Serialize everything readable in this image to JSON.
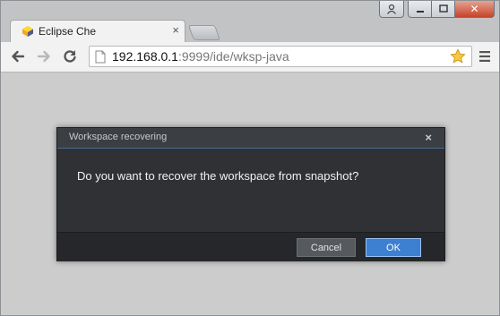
{
  "browser": {
    "tab": {
      "title": "Eclipse Che",
      "close_glyph": "×",
      "favicon": "eclipse-che-icon"
    },
    "window_controls": {
      "close_glyph": "✕"
    },
    "address": {
      "host": "192.168.0.1",
      "path": ":9999/ide/wksp-java"
    },
    "icons": [
      "back-arrow-icon",
      "forward-arrow-icon",
      "reload-icon",
      "page-icon",
      "star-icon",
      "menu-icon"
    ]
  },
  "dialog": {
    "title": "Workspace recovering",
    "close_glyph": "×",
    "message": "Do you want to recover the workspace from snapshot?",
    "cancel_label": "Cancel",
    "ok_label": "OK"
  },
  "colors": {
    "dialog_bg": "#2f3134",
    "primary_button": "#3d7fd1",
    "page_bg": "#cccccc"
  }
}
